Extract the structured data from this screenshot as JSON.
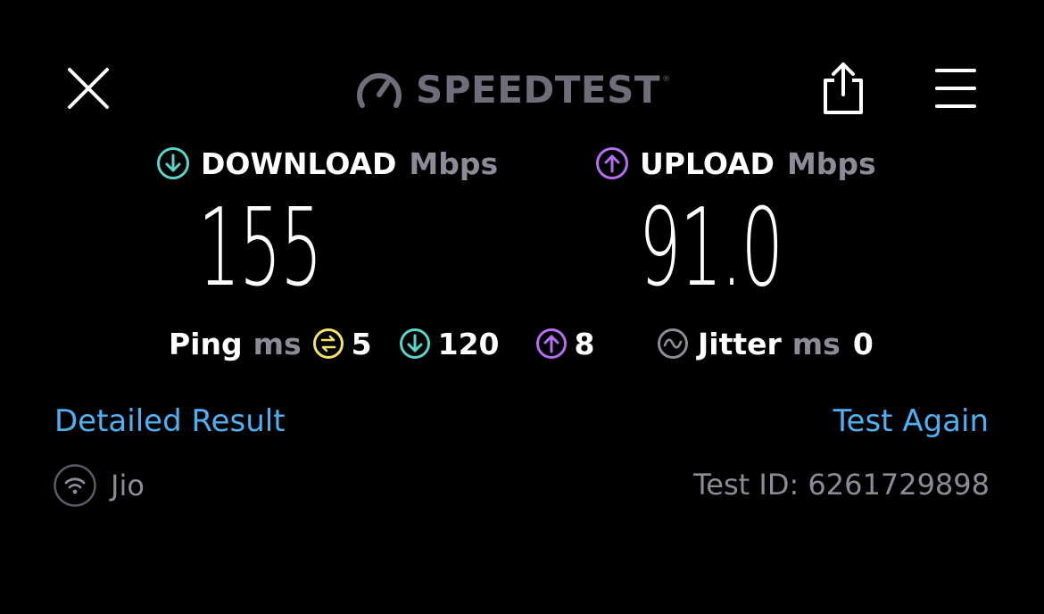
{
  "header": {
    "logo_text": "SPEEDTEST",
    "logo_tm": "®",
    "icons": [
      "close-icon",
      "gauge-icon",
      "share-icon",
      "menu-icon"
    ]
  },
  "download": {
    "title": "DOWNLOAD",
    "unit": "Mbps",
    "value": "155",
    "icon": "download-arrow-icon",
    "color": "#5ad4c8"
  },
  "upload": {
    "title": "UPLOAD",
    "unit": "Mbps",
    "value": "91.0",
    "icon": "upload-arrow-icon",
    "color": "#b46ef0"
  },
  "ping": {
    "label": "Ping",
    "unit": "ms",
    "idle": "5",
    "download": "120",
    "upload": "8",
    "idle_color": "#f2e36c"
  },
  "jitter": {
    "label": "Jitter",
    "unit": "ms",
    "value": "0",
    "icon": "jitter-wave-icon"
  },
  "links": {
    "detailed_result": "Detailed Result",
    "test_again": "Test Again"
  },
  "footer": {
    "isp": "Jio",
    "isp_icon": "wifi-icon",
    "test_id": "Test ID: 6261729898"
  },
  "colors": {
    "background": "#000000",
    "link": "#4eb0f0",
    "muted": "#8c8c99"
  }
}
